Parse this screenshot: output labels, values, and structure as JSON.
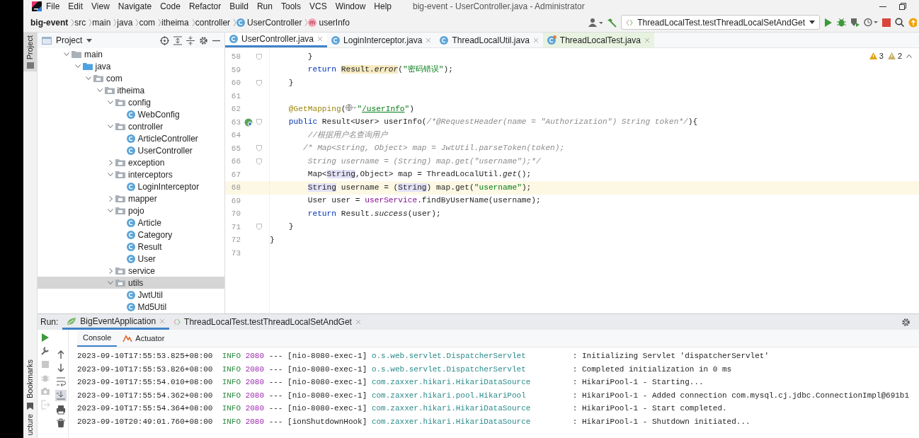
{
  "window": {
    "title": "big-event - UserController.java - Administrator"
  },
  "menu": [
    "File",
    "Edit",
    "View",
    "Navigate",
    "Code",
    "Refactor",
    "Build",
    "Run",
    "Tools",
    "VCS",
    "Window",
    "Help"
  ],
  "breadcrumbs": [
    {
      "label": "big-event",
      "kind": "project"
    },
    {
      "label": "src",
      "kind": "folder"
    },
    {
      "label": "main",
      "kind": "folder"
    },
    {
      "label": "java",
      "kind": "folder"
    },
    {
      "label": "com",
      "kind": "folder"
    },
    {
      "label": "itheima",
      "kind": "folder"
    },
    {
      "label": "controller",
      "kind": "folder"
    },
    {
      "label": "UserController",
      "kind": "class"
    },
    {
      "label": "userInfo",
      "kind": "method"
    }
  ],
  "run_config": {
    "label": "ThreadLocalTest.testThreadLocalSetAndGet"
  },
  "left_stripe": {
    "top": [
      {
        "label": "Project",
        "selected": true
      }
    ],
    "bottom": [
      {
        "label": "Bookmarks",
        "selected": false
      },
      {
        "label": "ucture",
        "selected": false
      }
    ]
  },
  "project_panel": {
    "title": "Project",
    "tree": [
      {
        "label": "main",
        "kind": "folder",
        "expanded": true,
        "selected": false,
        "children": [
          {
            "label": "java",
            "kind": "source",
            "expanded": true,
            "selected": false,
            "children": [
              {
                "label": "com",
                "kind": "package",
                "expanded": true,
                "selected": false,
                "children": [
                  {
                    "label": "itheima",
                    "kind": "package",
                    "expanded": true,
                    "selected": false,
                    "children": [
                      {
                        "label": "config",
                        "kind": "package",
                        "expanded": true,
                        "selected": false,
                        "children": [
                          {
                            "label": "WebConfig",
                            "kind": "class",
                            "selected": false
                          }
                        ]
                      },
                      {
                        "label": "controller",
                        "kind": "package",
                        "expanded": true,
                        "selected": false,
                        "children": [
                          {
                            "label": "ArticleController",
                            "kind": "class",
                            "selected": false
                          },
                          {
                            "label": "UserController",
                            "kind": "class",
                            "selected": false
                          }
                        ]
                      },
                      {
                        "label": "exception",
                        "kind": "package",
                        "expanded": false,
                        "selected": false
                      },
                      {
                        "label": "interceptors",
                        "kind": "package",
                        "expanded": true,
                        "selected": false,
                        "children": [
                          {
                            "label": "LoginInterceptor",
                            "kind": "class",
                            "selected": false
                          }
                        ]
                      },
                      {
                        "label": "mapper",
                        "kind": "package",
                        "expanded": false,
                        "selected": false
                      },
                      {
                        "label": "pojo",
                        "kind": "package",
                        "expanded": true,
                        "selected": false,
                        "children": [
                          {
                            "label": "Article",
                            "kind": "class",
                            "selected": false
                          },
                          {
                            "label": "Category",
                            "kind": "class",
                            "selected": false
                          },
                          {
                            "label": "Result",
                            "kind": "class",
                            "selected": false
                          },
                          {
                            "label": "User",
                            "kind": "class",
                            "selected": false
                          }
                        ]
                      },
                      {
                        "label": "service",
                        "kind": "package",
                        "expanded": false,
                        "selected": false
                      },
                      {
                        "label": "utils",
                        "kind": "package",
                        "expanded": true,
                        "selected": true,
                        "children": [
                          {
                            "label": "JwtUtil",
                            "kind": "class",
                            "selected": false
                          },
                          {
                            "label": "Md5Util",
                            "kind": "class",
                            "selected": false
                          }
                        ]
                      }
                    ]
                  }
                ]
              }
            ]
          }
        ]
      }
    ]
  },
  "editor_tabs": [
    {
      "label": "UserController.java",
      "kind": "class",
      "selected": true
    },
    {
      "label": "LoginInterceptor.java",
      "kind": "class",
      "selected": false
    },
    {
      "label": "ThreadLocalUtil.java",
      "kind": "class",
      "selected": false
    },
    {
      "label": "ThreadLocalTest.java",
      "kind": "test",
      "selected": false
    }
  ],
  "inspections": {
    "warnings": "3",
    "weak_warnings": "2"
  },
  "editor": {
    "lines": [
      {
        "number": "58",
        "kind": "code",
        "fold": true,
        "current": false,
        "tokens": [
          {
            "text": "        }",
            "kind": "plain"
          }
        ]
      },
      {
        "number": "59",
        "kind": "code",
        "fold": false,
        "current": false,
        "tokens": [
          {
            "text": "        return ",
            "kind": "keyword"
          },
          {
            "text": "Result.",
            "kind": "usage"
          },
          {
            "text": "error",
            "kind": "usage-static"
          },
          {
            "text": "(",
            "kind": "plain"
          },
          {
            "text": "\"密码错误\"",
            "kind": "string"
          },
          {
            "text": ");",
            "kind": "plain"
          }
        ]
      },
      {
        "number": "60",
        "kind": "code",
        "fold": true,
        "current": false,
        "tokens": [
          {
            "text": "    }",
            "kind": "plain"
          }
        ]
      },
      {
        "number": "61",
        "kind": "code",
        "fold": false,
        "current": false
      },
      {
        "number": "62",
        "kind": "code",
        "fold": false,
        "current": false,
        "tokens": [
          {
            "text": "    @GetMapping",
            "kind": "annotation"
          },
          {
            "text": "(",
            "kind": "plain"
          },
          {
            "kind": "inlay"
          },
          {
            "text": "\"",
            "kind": "string"
          },
          {
            "text": "/userInfo",
            "kind": "link"
          },
          {
            "text": "\"",
            "kind": "string"
          },
          {
            "text": ")",
            "kind": "plain"
          }
        ]
      },
      {
        "number": "63",
        "kind": "endpoint",
        "fold": true,
        "current": false,
        "tokens": [
          {
            "text": "    public",
            "kind": "keyword"
          },
          {
            "text": " Result<User> userInfo(",
            "kind": "plain"
          },
          {
            "text": "/*@RequestHeader(name = \"Authorization\") String token*/",
            "kind": "comment"
          },
          {
            "text": "){",
            "kind": "plain"
          }
        ]
      },
      {
        "number": "64",
        "kind": "code",
        "fold": false,
        "current": false,
        "tokens": [
          {
            "text": "        //根据用户名查询用户",
            "kind": "comment"
          }
        ]
      },
      {
        "number": "65",
        "kind": "code",
        "fold": true,
        "current": false,
        "tokens": [
          {
            "text": "       /* Map<String, Object> map = JwtUtil.parseToken(token);",
            "kind": "comment"
          }
        ]
      },
      {
        "number": "66",
        "kind": "code",
        "fold": true,
        "current": false,
        "tokens": [
          {
            "text": "        String username = (String) map.get(\"username\");*/",
            "kind": "comment"
          }
        ]
      },
      {
        "number": "67",
        "kind": "code",
        "fold": false,
        "current": false,
        "tokens": [
          {
            "text": "        Map<",
            "kind": "plain"
          },
          {
            "text": "String",
            "kind": "ref"
          },
          {
            "text": ",Object> map = ThreadLocalUtil.",
            "kind": "plain"
          },
          {
            "text": "get",
            "kind": "static"
          },
          {
            "text": "();",
            "kind": "plain"
          }
        ]
      },
      {
        "number": "68",
        "kind": "code",
        "fold": false,
        "current": true,
        "tokens": [
          {
            "text": "        String",
            "kind": "ref"
          },
          {
            "text": " username = (",
            "kind": "plain"
          },
          {
            "text": "String",
            "kind": "ref"
          },
          {
            "text": ") map.get(",
            "kind": "plain"
          },
          {
            "text": "\"username\"",
            "kind": "string"
          },
          {
            "text": ");",
            "kind": "plain"
          }
        ]
      },
      {
        "number": "69",
        "kind": "code",
        "fold": false,
        "current": false,
        "tokens": [
          {
            "text": "        User user = ",
            "kind": "plain"
          },
          {
            "text": "userService",
            "kind": "field"
          },
          {
            "text": ".findByUserName(username);",
            "kind": "plain"
          }
        ]
      },
      {
        "number": "70",
        "kind": "code",
        "fold": false,
        "current": false,
        "tokens": [
          {
            "text": "        return",
            "kind": "keyword"
          },
          {
            "text": " Result.",
            "kind": "plain"
          },
          {
            "text": "success",
            "kind": "static"
          },
          {
            "text": "(user);",
            "kind": "plain"
          }
        ]
      },
      {
        "number": "71",
        "kind": "code",
        "fold": true,
        "current": false,
        "tokens": [
          {
            "text": "    }",
            "kind": "plain"
          }
        ]
      },
      {
        "number": "72",
        "kind": "code",
        "fold": false,
        "current": false,
        "tokens": [
          {
            "text": "}",
            "kind": "plain"
          }
        ]
      },
      {
        "number": "73",
        "kind": "code",
        "fold": false,
        "current": false
      }
    ]
  },
  "run_panel": {
    "label": "Run:",
    "tabs": [
      {
        "label": "BigEventApplication",
        "kind": "spring",
        "selected": true
      },
      {
        "label": "ThreadLocalTest.testThreadLocalSetAndGet",
        "kind": "test",
        "selected": false
      }
    ],
    "subtabs": [
      {
        "label": "Console",
        "kind": "console",
        "selected": true
      },
      {
        "label": "Actuator",
        "kind": "actuator",
        "selected": false
      }
    ],
    "log": [
      {
        "time": "2023-09-10T17:55:53.825+08:00",
        "level": "INFO",
        "pid": "2080",
        "sep": "---",
        "thread": "[nio-8080-exec-1]",
        "logger": "o.s.web.servlet.DispatcherServlet",
        "message": ": Initializing Servlet 'dispatcherServlet'"
      },
      {
        "time": "2023-09-10T17:55:53.826+08:00",
        "level": "INFO",
        "pid": "2080",
        "sep": "---",
        "thread": "[nio-8080-exec-1]",
        "logger": "o.s.web.servlet.DispatcherServlet",
        "message": ": Completed initialization in 0 ms"
      },
      {
        "time": "2023-09-10T17:55:54.010+08:00",
        "level": "INFO",
        "pid": "2080",
        "sep": "---",
        "thread": "[nio-8080-exec-1]",
        "logger": "com.zaxxer.hikari.HikariDataSource",
        "message": ": HikariPool-1 - Starting..."
      },
      {
        "time": "2023-09-10T17:55:54.362+08:00",
        "level": "INFO",
        "pid": "2080",
        "sep": "---",
        "thread": "[nio-8080-exec-1]",
        "logger": "com.zaxxer.hikari.pool.HikariPool",
        "message": ": HikariPool-1 - Added connection com.mysql.cj.jdbc.ConnectionImpl@691b1"
      },
      {
        "time": "2023-09-10T17:55:54.364+08:00",
        "level": "INFO",
        "pid": "2080",
        "sep": "---",
        "thread": "[nio-8080-exec-1]",
        "logger": "com.zaxxer.hikari.HikariDataSource",
        "message": ": HikariPool-1 - Start completed."
      },
      {
        "time": "2023-09-10T20:49:01.760+08:00",
        "level": "INFO",
        "pid": "2080",
        "sep": "---",
        "thread": "[ionShutdownHook]",
        "logger": "com.zaxxer.hikari.HikariDataSource",
        "message": ": HikariPool-1 - Shutdown initiated..."
      }
    ]
  }
}
